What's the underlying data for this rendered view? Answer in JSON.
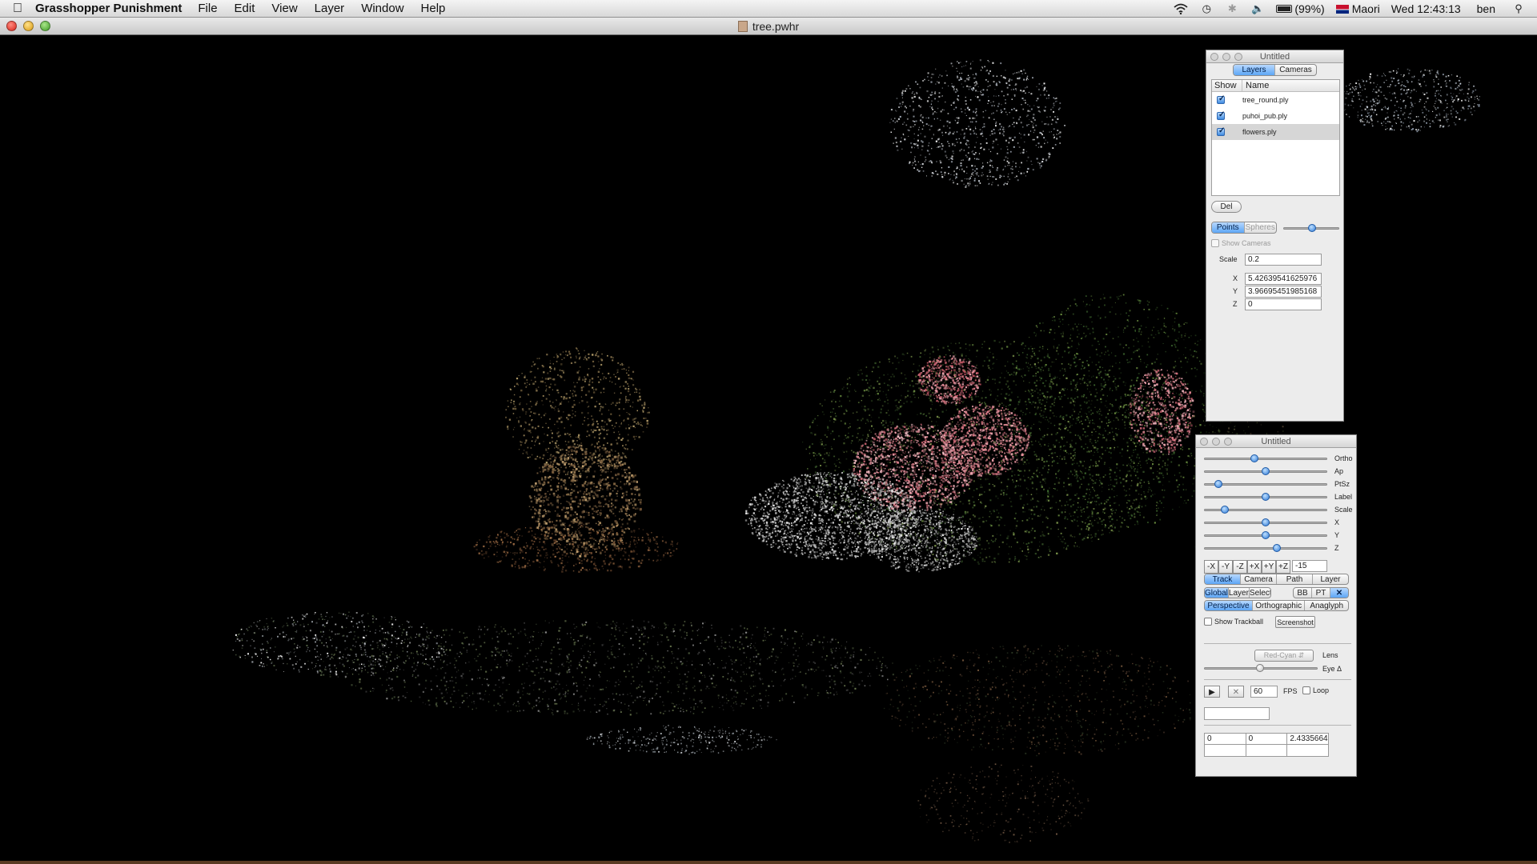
{
  "menubar": {
    "app_name": "Grasshopper Punishment",
    "menus": [
      "File",
      "Edit",
      "View",
      "Layer",
      "Window",
      "Help"
    ],
    "battery": "(99%)",
    "input_source": "Maori",
    "clock": "Wed 12:43:13",
    "user": "ben"
  },
  "window": {
    "title": "tree.pwhr"
  },
  "layers_panel": {
    "title": "Untitled",
    "tabs": [
      {
        "label": "Layers",
        "selected": true
      },
      {
        "label": "Cameras",
        "selected": false
      }
    ],
    "columns": [
      "Show",
      "Name"
    ],
    "layers": [
      {
        "name": "tree_round.ply",
        "show": true,
        "selected": false
      },
      {
        "name": "puhoi_pub.ply",
        "show": true,
        "selected": false
      },
      {
        "name": "flowers.ply",
        "show": true,
        "selected": true
      }
    ],
    "del_label": "Del",
    "render_modes": [
      {
        "label": "Points",
        "selected": true
      },
      {
        "label": "Spheres",
        "selected": false
      }
    ],
    "render_size_level": 0.52,
    "show_cameras_label": "Show Cameras",
    "scale_label": "Scale",
    "scale_value": "0.2",
    "x_label": "X",
    "x_value": "5.42639541625976",
    "y_label": "Y",
    "y_value": "3.96695451985168",
    "z_label": "Z",
    "z_value": "0"
  },
  "controls_panel": {
    "title": "Untitled",
    "sliders": [
      {
        "label": "Ortho",
        "level": 0.41
      },
      {
        "label": "Ap",
        "level": 0.5
      },
      {
        "label": "PtSz",
        "level": 0.12
      },
      {
        "label": "Label",
        "level": 0.5
      },
      {
        "label": "Scale",
        "level": 0.17
      },
      {
        "label": "X",
        "level": 0.5
      },
      {
        "label": "Y",
        "level": 0.5
      },
      {
        "label": "Z",
        "level": 0.59
      }
    ],
    "axis_buttons": [
      "-X",
      "-Y",
      "-Z",
      "+X",
      "+Y",
      "+Z"
    ],
    "axis_value": "-15",
    "mode_tabs": [
      {
        "label": "Track",
        "selected": true
      },
      {
        "label": "Camera",
        "selected": false
      },
      {
        "label": "Path",
        "selected": false
      },
      {
        "label": "Layer",
        "selected": false
      }
    ],
    "frame_tabs": [
      {
        "label": "Global",
        "selected": true
      },
      {
        "label": "Layer",
        "selected": false
      },
      {
        "label": "Select",
        "selected": false
      }
    ],
    "bb_label": "BB",
    "pt_label": "PT",
    "projection_tabs": [
      {
        "label": "Perspective",
        "selected": true
      },
      {
        "label": "Orthographic",
        "selected": false
      },
      {
        "label": "Anaglyph",
        "selected": false
      }
    ],
    "show_trackball_label": "Show Trackball",
    "screenshot_label": "Screenshot",
    "lens_select": "Red-Cyan",
    "lens_label": "Lens",
    "eye_label": "Eye Δ",
    "eye_level": 0.49,
    "fps_value": "60",
    "fps_label": "FPS",
    "loop_label": "Loop",
    "status_field": "",
    "coords": [
      "0",
      "0",
      "2.4335664"
    ]
  }
}
